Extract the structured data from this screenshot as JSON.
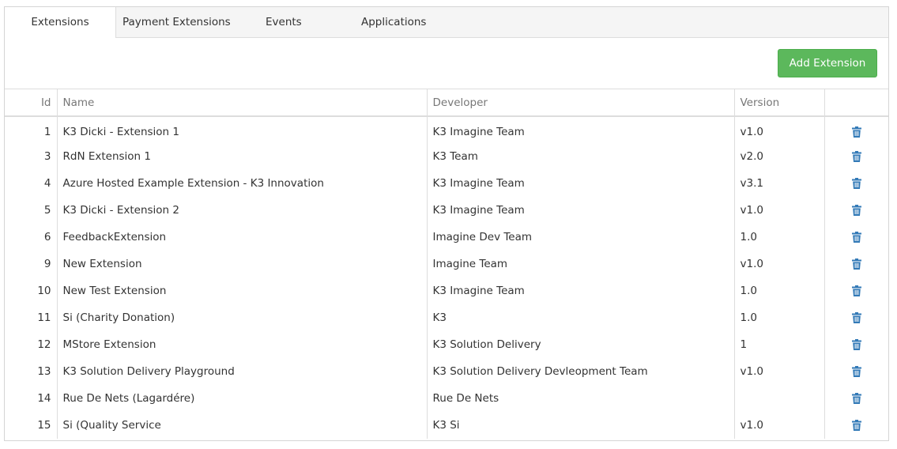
{
  "tabs": [
    {
      "label": "Extensions",
      "active": true
    },
    {
      "label": "Payment Extensions",
      "active": false
    },
    {
      "label": "Events",
      "active": false
    },
    {
      "label": "Applications",
      "active": false
    }
  ],
  "toolbar": {
    "add_label": "Add Extension"
  },
  "colors": {
    "accent": "#5cb85c",
    "trash": "#337ab7"
  },
  "table": {
    "columns": [
      "Id",
      "Name",
      "Developer",
      "Version",
      ""
    ],
    "rows": [
      {
        "id": "1",
        "name": "K3 Dicki - Extension 1",
        "developer": "K3 Imagine Team",
        "version": "v1.0"
      },
      {
        "id": "3",
        "name": "RdN Extension 1",
        "developer": "K3 Team",
        "version": "v2.0"
      },
      {
        "id": "4",
        "name": "Azure Hosted Example Extension - K3 Innovation",
        "developer": "K3 Imagine Team",
        "version": "v3.1"
      },
      {
        "id": "5",
        "name": "K3 Dicki - Extension 2",
        "developer": "K3 Imagine Team",
        "version": "v1.0"
      },
      {
        "id": "6",
        "name": "FeedbackExtension",
        "developer": "Imagine Dev Team",
        "version": "1.0"
      },
      {
        "id": "9",
        "name": "New Extension",
        "developer": "Imagine Team",
        "version": "v1.0"
      },
      {
        "id": "10",
        "name": "New Test Extension",
        "developer": "K3 Imagine Team",
        "version": "1.0"
      },
      {
        "id": "11",
        "name": "Si (Charity Donation)",
        "developer": "K3",
        "version": "1.0"
      },
      {
        "id": "12",
        "name": "MStore Extension",
        "developer": "K3 Solution Delivery",
        "version": "1"
      },
      {
        "id": "13",
        "name": "K3 Solution Delivery Playground",
        "developer": "K3 Solution Delivery Devleopment Team",
        "version": "v1.0"
      },
      {
        "id": "14",
        "name": "Rue De Nets (Lagardére)",
        "developer": "Rue De Nets",
        "version": ""
      },
      {
        "id": "15",
        "name": "Si (Quality Service",
        "developer": "K3 Si",
        "version": "v1.0"
      }
    ]
  }
}
